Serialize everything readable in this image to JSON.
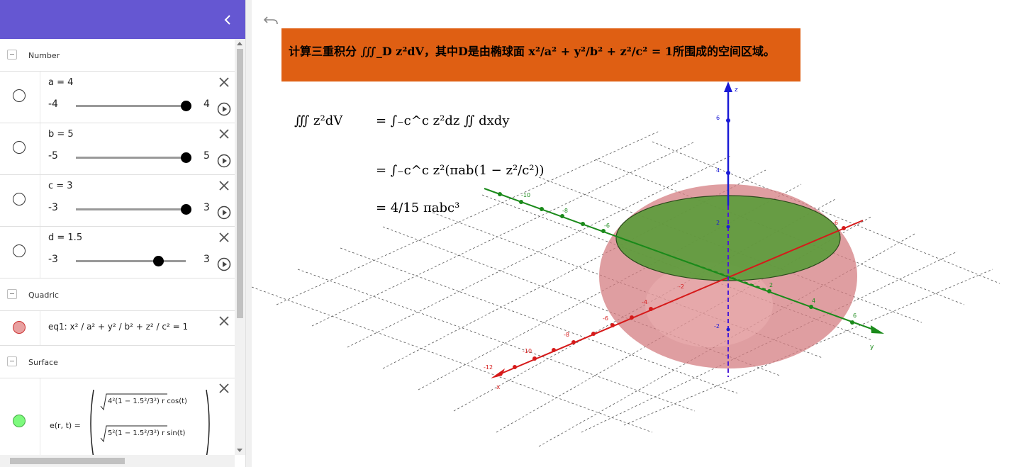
{
  "colors": {
    "header": "#6557d2",
    "banner": "#df5f13",
    "quadric": "#e8a0a0",
    "surface": "#5a9b3a"
  },
  "sidebar": {
    "collapse_icon": "chevron-left-icon",
    "sections": [
      {
        "label": "Number"
      },
      {
        "label": "Quadric"
      },
      {
        "label": "Surface"
      }
    ],
    "sliders": [
      {
        "def": "a = 4",
        "min": "-4",
        "max": "4",
        "value": 4,
        "lo": -4,
        "hi": 4
      },
      {
        "def": "b = 5",
        "min": "-5",
        "max": "5",
        "value": 5,
        "lo": -5,
        "hi": 5
      },
      {
        "def": "c = 3",
        "min": "-3",
        "max": "3",
        "value": 3,
        "lo": -3,
        "hi": 3
      },
      {
        "def": "d = 1.5",
        "min": "-3",
        "max": "3",
        "value": 1.5,
        "lo": -3,
        "hi": 3
      }
    ],
    "quadric": {
      "def": "eq1: x² / a² + y² / b² + z² / c² = 1"
    },
    "surface": {
      "name": "e(r, t)  =",
      "row1": "4²(1 − 1.5²/3²)  r  cos(t)",
      "row2": "5²(1 − 1.5²/3²)  r  sin(t)"
    }
  },
  "banner": {
    "text": "计算三重积分 ∭_D z²dV，其中D是由椭球面 x²/a² + y²/b² + z²/c² = 1所围成的空间区域。"
  },
  "solution": {
    "line1_lhs": "∭ z²dV",
    "line1_rhs": "= ∫₋c^c z²dz ∬ dxdy",
    "line2": "= ∫₋c^c z²(πab(1 − z²/c²))",
    "line3": "= 4/15 πabc³"
  },
  "axes": {
    "x_label": "x",
    "y_label": "y",
    "z_label": "z",
    "z_ticks": [
      "6",
      "4",
      "2",
      "-2"
    ],
    "x_ticks": [
      "-12",
      "-10",
      "-8",
      "-6",
      "-4",
      "-2"
    ],
    "y_ticks": [
      "2",
      "4",
      "6"
    ],
    "green_ticks": [
      "-10",
      "-8",
      "-6"
    ],
    "red_back_tick": "-6",
    "origin_labels": [
      "-2",
      "2"
    ]
  }
}
